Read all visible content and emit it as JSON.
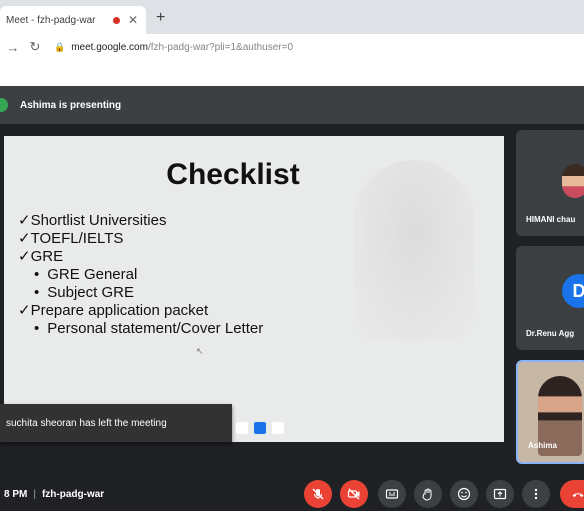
{
  "browser": {
    "tab_title": "Meet - fzh-padg-war",
    "address_host": "meet.google.com",
    "address_path": "/fzh-padg-war?pli=1&authuser=0"
  },
  "meet": {
    "presenting_text": "Ashima is presenting",
    "slide": {
      "title": "Checklist",
      "items": [
        "✓Shortlist Universities",
        "✓TOEFL/IELTS",
        "✓GRE",
        "GRE General",
        "Subject GRE",
        "✓Prepare application packet",
        "Personal statement/Cover Letter"
      ]
    },
    "toast": "suchita sheoran has left the meeting",
    "participants": [
      {
        "name": "HIMANI chau"
      },
      {
        "name": "Dr.Renu Agg",
        "initial": "D"
      },
      {
        "name": "Ashima"
      }
    ],
    "meeting_time": "8 PM",
    "meeting_code": "fzh-padg-war"
  },
  "colors": {
    "danger": "#ea4335",
    "accent": "#1a73e8",
    "control_bg": "#3c4043"
  }
}
